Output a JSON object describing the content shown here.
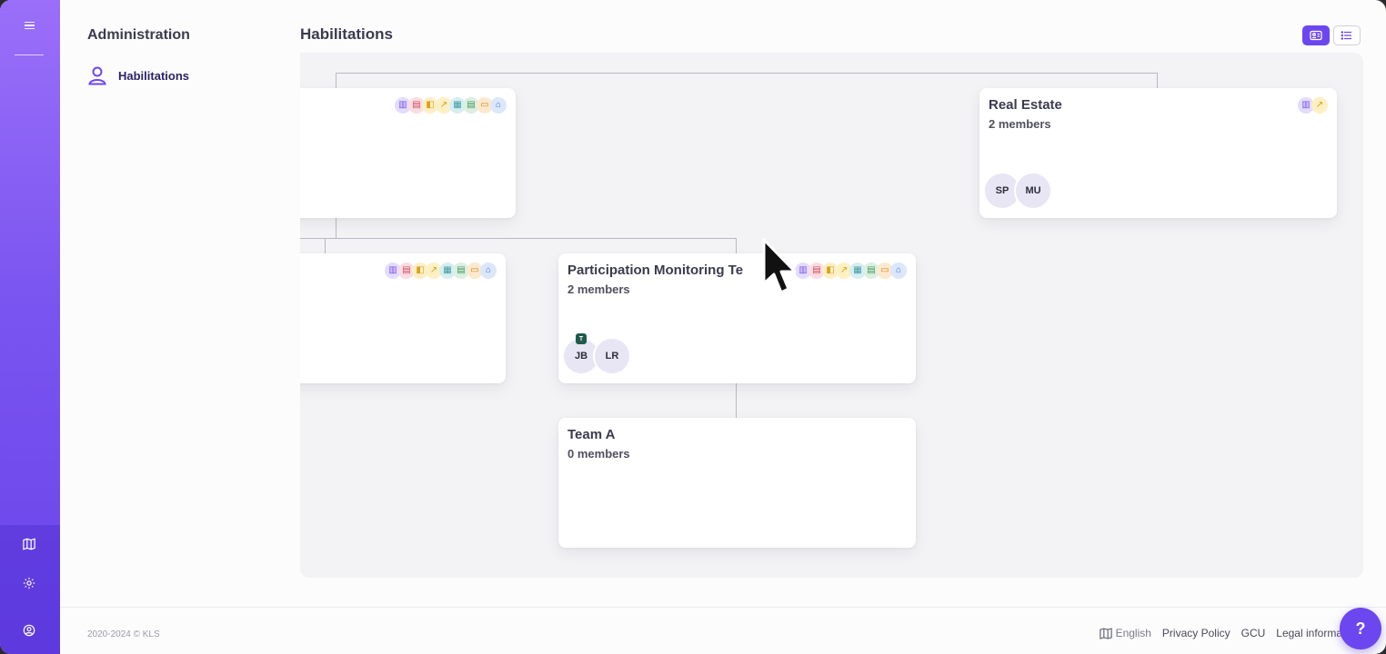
{
  "sidebar": {
    "menu_icon": "hamburger-icon",
    "bottom_icons": [
      "map-icon",
      "gear-icon",
      "user-circle-icon"
    ]
  },
  "subnav": {
    "title": "Administration",
    "item_label": "Habilitations",
    "item_icon": "user-icon"
  },
  "main": {
    "title": "Habilitations",
    "view_toggle": {
      "active": "card-view-icon",
      "inactive": "list-view-icon"
    }
  },
  "org": {
    "top_left_card": {
      "title": "",
      "members": ""
    },
    "real_estate_card": {
      "title": "Real Estate",
      "members": "2 members",
      "avatars": [
        "SP",
        "MU"
      ]
    },
    "mid_left_card": {
      "title": "",
      "members": ""
    },
    "participation_card": {
      "title": "Participation Monitoring Te",
      "members": "2 members",
      "avatars": [
        "JB",
        "LR"
      ],
      "badge": "T"
    },
    "team_a_card": {
      "title": "Team A",
      "members": "0 members"
    }
  },
  "footer": {
    "copyright": "2020-2024 © KLS",
    "language": "English",
    "links": [
      "Privacy Policy",
      "GCU",
      "Legal informa"
    ]
  },
  "help_button": "?",
  "colors": {
    "primary": "#6c47f0",
    "rail_top": "#9a6ff9",
    "rail_bottom": "#6a43ea"
  }
}
